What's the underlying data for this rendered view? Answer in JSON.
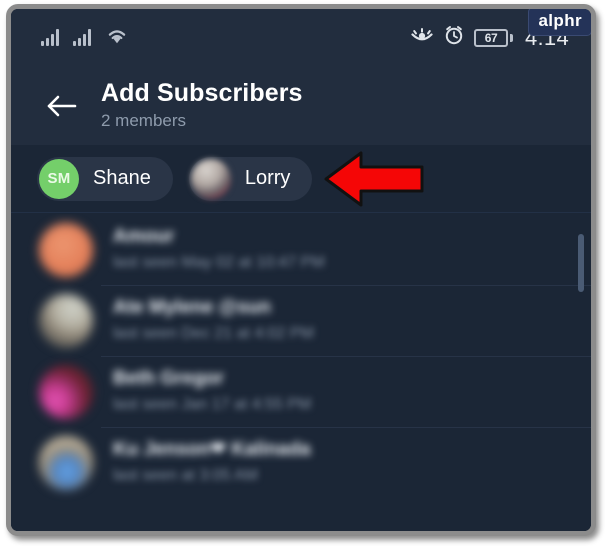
{
  "watermark": {
    "label": "alphr"
  },
  "status_bar": {
    "time": "4:14",
    "battery_level": "67",
    "icons": [
      "signal-bars-icon",
      "signal-bars-icon",
      "wifi-icon",
      "eye-icon",
      "alarm-clock-icon",
      "battery-icon"
    ]
  },
  "header": {
    "back_icon": "back-arrow-icon",
    "title": "Add Subscribers",
    "subtitle": "2 members"
  },
  "selected_chips": [
    {
      "name": "Shane",
      "initials": "SM",
      "avatar_type": "initials",
      "avatar_color": "#74cf6a"
    },
    {
      "name": "Lorry",
      "initials": "",
      "avatar_type": "photo",
      "avatar_color": "#8d7d80"
    }
  ],
  "contacts": [
    {
      "name": "Amour",
      "status": "last seen May 02 at 10:47 PM",
      "avatar_style": "av-orange",
      "blurred": true
    },
    {
      "name": "Ate Mylene @sun",
      "status": "last seen Dec 21 at 4:02 PM",
      "avatar_style": "av-blonde",
      "blurred": true
    },
    {
      "name": "Beth Gregor",
      "status": "last seen Jan 17 at 4:55 PM",
      "avatar_style": "av-pink",
      "blurred": true
    },
    {
      "name": "Ku Jenson❤ Kalinada",
      "status": "last seen at 3:05 AM",
      "avatar_style": "av-blue",
      "blurred": true
    }
  ],
  "annotation": {
    "arrow_icon": "red-left-arrow-annotation",
    "color": "#f50606",
    "outline_color": "#111111",
    "direction": "left"
  },
  "colors": {
    "screen_bg": "#1b2636",
    "header_bg": "#222d3e",
    "chip_bg": "#2a3547",
    "divider": "#273347",
    "frame_border": "#8c8c8c",
    "text_primary": "#ffffff",
    "text_secondary": "#8e9bac"
  },
  "scrollbar": {
    "name": "list-scrollbar"
  }
}
